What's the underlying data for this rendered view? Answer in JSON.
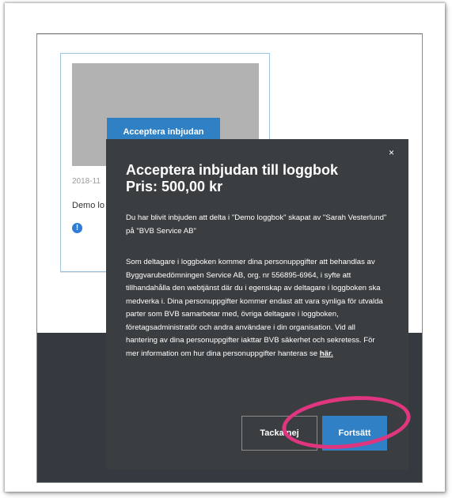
{
  "card": {
    "button_label": "Acceptera inbjudan",
    "date": "2018-11",
    "title": "Demo lo",
    "info_icon": "info-circle-icon"
  },
  "modal": {
    "close_label": "×",
    "title": "Acceptera inbjudan till loggbok",
    "price": "Pris: 500,00 kr",
    "intro": "Du har blivit inbjuden att delta i \"Demo loggbok\" skapat av \"Sarah Vesterlund\" på \"BVB Service AB\"",
    "body": "Som deltagare i loggboken kommer dina personuppgifter att behandlas av Byggvarubedömningen Service AB, org. nr 556895-6964, i syfte att tillhandahålla den webtjänst där du i egenskap av deltagare i loggboken ska medverka i. Dina personuppgifter kommer endast att vara synliga för utvalda parter som BVB samarbetar med, övriga deltagare i loggboken, företagsadministratör och andra användare i din organisation. Vid all hantering av dina personuppgifter iakttar BVB säkerhet och sekretess. För mer information om hur dina personuppgifter hanteras se ",
    "link_label": "här.",
    "decline_label": "Tacka nej",
    "continue_label": "Fortsätt"
  },
  "colors": {
    "accent": "#2f80c5",
    "modal_bg": "#3a3e41",
    "highlight": "#e0357f"
  }
}
